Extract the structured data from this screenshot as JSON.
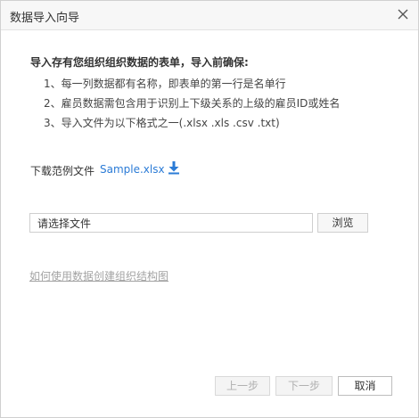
{
  "dialog": {
    "title": "数据导入向导",
    "close_icon": "close-icon"
  },
  "instructions": {
    "heading": "导入存有您组织组织数据的表单，导入前确保:",
    "rules": [
      "1、每一列数据都有名称，即表单的第一行是名单行",
      "2、雇员数据需包含用于识别上下级关系的上级的雇员ID或姓名",
      "3、导入文件为以下格式之一(.xlsx .xls .csv .txt)"
    ]
  },
  "download": {
    "label": "下载范例文件",
    "link_text": "Sample.xlsx",
    "icon": "download-icon"
  },
  "file_picker": {
    "placeholder": "请选择文件",
    "browse_label": "浏览"
  },
  "help_link": "如何使用数据创建组织结构图",
  "footer": {
    "prev_label": "上一步",
    "next_label": "下一步",
    "cancel_label": "取消"
  },
  "colors": {
    "link": "#2b7bd6",
    "disabled_text": "#b0b0b0",
    "help_link": "#a3a3a3"
  }
}
